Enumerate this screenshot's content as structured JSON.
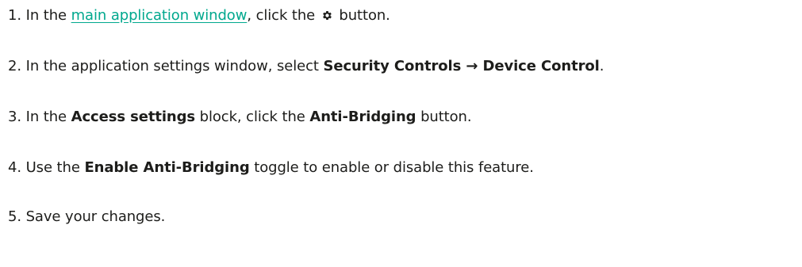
{
  "steps": [
    {
      "number": "1.",
      "text_before": "In the",
      "link_text": "main application window",
      "text_middle": ", click the",
      "icon": "gear-icon",
      "text_after": "button."
    },
    {
      "number": "2.",
      "text_before": "In the application settings window, select",
      "bold_path": "Security Controls → Device Control",
      "text_after": "."
    },
    {
      "number": "3.",
      "text_before": "In the",
      "bold_block": "Access settings",
      "text_middle": "block, click the",
      "bold_button": "Anti-Bridging",
      "text_after": "button."
    },
    {
      "number": "4.",
      "text_before": "Use the",
      "bold_toggle": "Enable Anti-Bridging",
      "text_after": "toggle to enable or disable this feature."
    },
    {
      "number": "5.",
      "text": "Save your changes."
    }
  ],
  "colors": {
    "link": "#00a88e",
    "text": "#1d1d1b"
  }
}
